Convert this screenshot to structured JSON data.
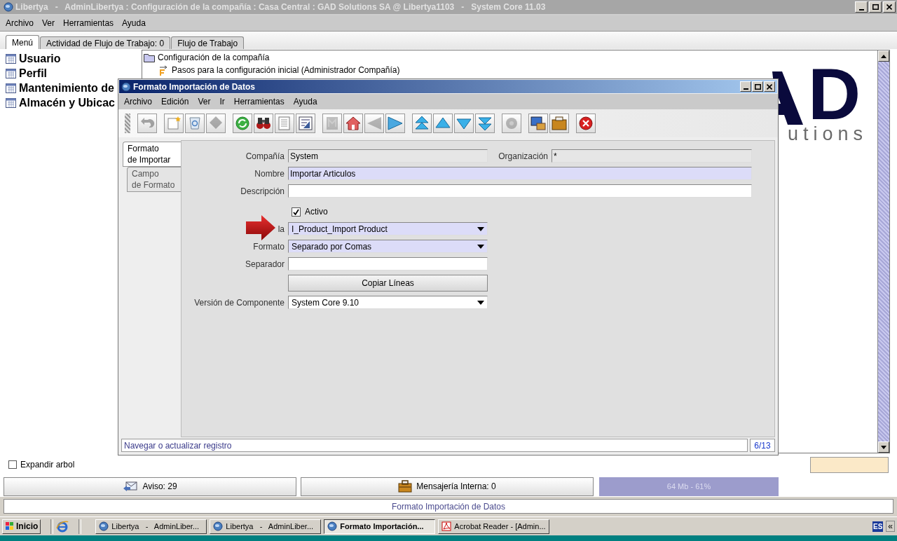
{
  "window": {
    "title": "Libertya   -   AdminLibertya : Configuración de la compañía : Casa Central : GAD Solutions SA @ Libertya1103   -   System Core 11.03"
  },
  "menu": [
    "Archivo",
    "Ver",
    "Herramientas",
    "Ayuda"
  ],
  "tabs": [
    {
      "label": "Menú",
      "selected": true
    },
    {
      "label": "Actividad de Flujo de Trabajo: 0",
      "selected": false
    },
    {
      "label": "Flujo de Trabajo",
      "selected": false
    }
  ],
  "favorites": [
    "Usuario",
    "Perfil",
    "Mantenimiento de",
    "Almacén y Ubicac"
  ],
  "tree": [
    {
      "label": "Configuración de la compañía",
      "kind": "folder",
      "children": [
        {
          "label": "Pasos para la configuración inicial (Administrador Compañía)",
          "kind": "workflow"
        }
      ]
    }
  ],
  "logo": {
    "mark": "D",
    "tagline": "utions"
  },
  "expand_tree": {
    "label": "Expandir arbol",
    "checked": false
  },
  "bottom_bar": {
    "notices": "Aviso: 29",
    "messages": "Mensajería Interna: 0",
    "memory": "64 Mb - 61%"
  },
  "status_line": "Formato Importación de Datos",
  "dialog": {
    "title": "Formato Importación de Datos",
    "menu": [
      "Archivo",
      "Edición",
      "Ver",
      "Ir",
      "Herramientas",
      "Ayuda"
    ],
    "toolbar": [
      [
        {
          "disabled": true
        }
      ],
      [
        {
          "disabled": false
        },
        {
          "disabled": false
        },
        {
          "disabled": true
        }
      ],
      [
        {
          "disabled": false
        },
        {
          "disabled": false
        },
        {
          "disabled": false
        },
        {
          "disabled": false
        }
      ],
      [
        {
          "disabled": true
        },
        {
          "disabled": false
        },
        {
          "disabled": true
        },
        {
          "disabled": false
        }
      ],
      [
        {
          "disabled": false
        },
        {
          "disabled": false
        },
        {
          "disabled": false
        },
        {
          "disabled": false
        }
      ],
      [
        {
          "disabled": true
        }
      ],
      [
        {
          "disabled": false
        },
        {
          "disabled": false
        }
      ],
      [
        {
          "disabled": false
        }
      ]
    ],
    "tabs": [
      {
        "label": "Formato\nde Importar",
        "selected": true
      },
      {
        "label": "Campo\nde Formato",
        "selected": false
      }
    ],
    "rows": [
      {
        "kind": "pair",
        "fields": [
          {
            "label": "Compañía",
            "value": "System",
            "readonly": true,
            "mandatory": false
          },
          {
            "label": "Organización",
            "value": "*",
            "readonly": true,
            "mandatory": false
          }
        ]
      },
      {
        "kind": "wide",
        "label": "Nombre",
        "value": "Importar Articulos",
        "mandatory": true
      },
      {
        "kind": "wide",
        "label": "Descripción",
        "value": "",
        "readonly": false,
        "mandatory": false
      },
      {
        "kind": "checkbox",
        "label": "Activo",
        "checked": true
      },
      {
        "kind": "combo",
        "label": "la",
        "value": "I_Product_Import Product",
        "mandatory": true
      },
      {
        "kind": "combo",
        "label": "Formato",
        "value": "Separado por Comas",
        "mandatory": true
      },
      {
        "kind": "text",
        "label": "Separador",
        "value": "",
        "readonly": false,
        "mandatory": false
      },
      {
        "kind": "button",
        "label": "Copiar Líneas"
      },
      {
        "kind": "combo",
        "label": "Versión de Componente",
        "value": "System Core 9.10",
        "readonly": false,
        "mandatory": false
      }
    ],
    "status": "Navegar o actualizar registro",
    "record": "6/13"
  },
  "taskbar": {
    "start": "Inicio",
    "tasks": [
      {
        "label": "Libertya   -   AdminLiber...",
        "kind": "app",
        "selected": false
      },
      {
        "label": "Libertya   -   AdminLiber...",
        "kind": "app",
        "selected": false
      },
      {
        "label": "Formato Importación...",
        "kind": "app",
        "selected": true
      },
      {
        "label": "Acrobat Reader - [Admin...",
        "kind": "pdf",
        "selected": false
      }
    ],
    "language": "ES",
    "collapse": "«"
  }
}
